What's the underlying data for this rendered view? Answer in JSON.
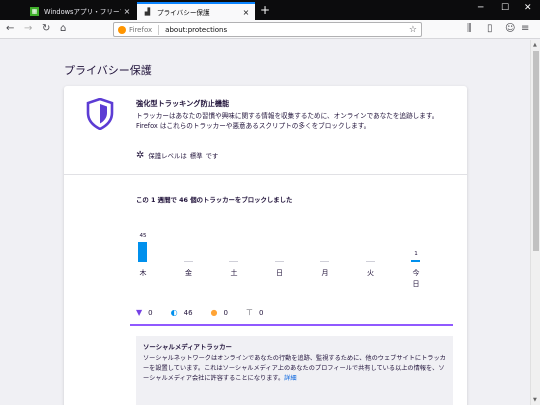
{
  "tabs": [
    {
      "label": "Windowsアプリ・フリーソフトのおすす",
      "icon": "site-favicon"
    },
    {
      "label": "プライバシー保護",
      "icon": "protections-icon"
    }
  ],
  "url": {
    "brand": "Firefox",
    "address": "about:protections"
  },
  "page": {
    "title": "プライバシー保護",
    "protection_title": "強化型トラッキング防止機能",
    "protection_desc": "トラッカーはあなたの習慣や興味に関する情報を収集するために、オンラインであなたを追跡します。Firefox はこれらのトラッカーや悪意あるスクリプトの多くをブロックします。",
    "level_label": "保護レベルは",
    "level_value": "標準",
    "level_suffix": "です",
    "week_summary": "この 1 週間で 46 個のトラッカーをブロックしました"
  },
  "chart_data": {
    "type": "bar",
    "categories": [
      "木",
      "金",
      "土",
      "日",
      "月",
      "火",
      "今日"
    ],
    "values": [
      45,
      0,
      0,
      0,
      0,
      0,
      1
    ],
    "labels": [
      "45",
      "",
      "",
      "",
      "",
      "",
      "1"
    ]
  },
  "tracker_tabs": [
    {
      "icon": "thumbs-down-icon",
      "count": "0",
      "color": "#7542e5"
    },
    {
      "icon": "cookie-icon",
      "count": "46",
      "color": "#0090ed"
    },
    {
      "icon": "fingerprint-icon",
      "count": "0",
      "color": "#ffa436"
    },
    {
      "icon": "cryptominer-icon",
      "count": "0",
      "color": "#5b5b66"
    }
  ],
  "detail": {
    "title": "ソーシャルメディアトラッカー",
    "text": "ソーシャルネットワークはオンラインであなたの行動を追跡、監視するために、他のウェブサイトにトラッカーを設置しています。これはソーシャルメディア上のあなたのプロフィールで共有している以上の情報を、ソーシャルメディア会社に許容することになります。",
    "link": "詳細"
  },
  "colors": {
    "bar": "#0090ed",
    "accent": "#9059ff",
    "shield": "#5c3cd4"
  }
}
